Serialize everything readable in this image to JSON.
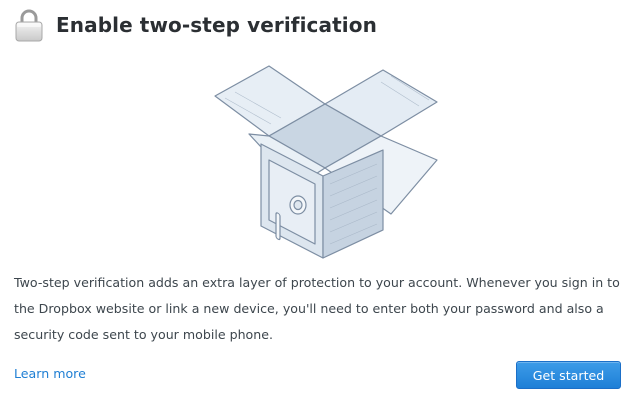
{
  "header": {
    "title": "Enable two-step verification",
    "icon": "lock-icon"
  },
  "illustration": {
    "icon": "open-box-with-safe-illustration"
  },
  "body": {
    "description": "Two-step verification adds an extra layer of protection to your account. Whenever you sign in to the Dropbox website or link a new device, you'll need to enter both your password and also a security code sent to your mobile phone."
  },
  "footer": {
    "learn_more_label": "Learn more",
    "get_started_label": "Get started"
  },
  "colors": {
    "link": "#1f7fd4",
    "primary_button": "#2a8ae0",
    "text": "#3d464d"
  }
}
